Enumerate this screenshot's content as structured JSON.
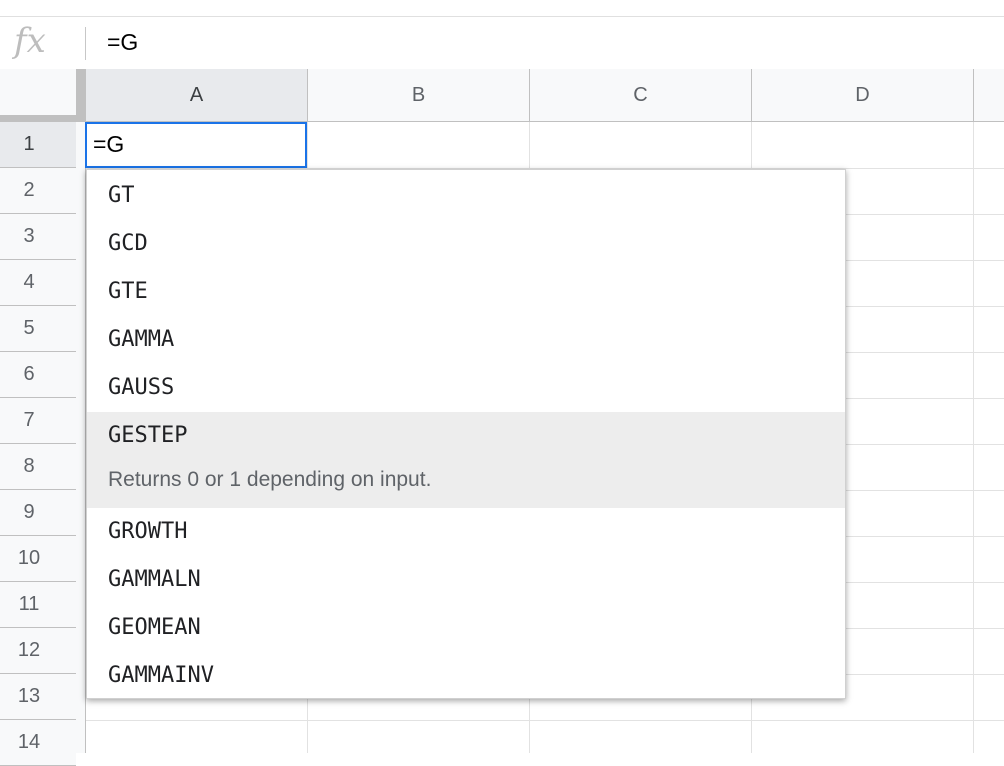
{
  "formula_bar": {
    "fx_label": "fx",
    "value": "=G"
  },
  "columns": [
    "A",
    "B",
    "C",
    "D"
  ],
  "rows": [
    "1",
    "2",
    "3",
    "4",
    "5",
    "6",
    "7",
    "8",
    "9",
    "10",
    "11",
    "12",
    "13",
    "14"
  ],
  "active_cell": {
    "column": "A",
    "row": "1",
    "value": "=G"
  },
  "autocomplete": {
    "suggestions": [
      {
        "name": "GT"
      },
      {
        "name": "GCD"
      },
      {
        "name": "GTE"
      },
      {
        "name": "GAMMA"
      },
      {
        "name": "GAUSS"
      },
      {
        "name": "GESTEP",
        "description": "Returns 0 or 1 depending on input.",
        "highlighted": true
      },
      {
        "name": "GROWTH"
      },
      {
        "name": "GAMMALN"
      },
      {
        "name": "GEOMEAN"
      },
      {
        "name": "GAMMAINV"
      }
    ]
  },
  "colors": {
    "selection_border": "#1a73e8",
    "header_bg": "#f8f9fa",
    "highlight_bg": "#ededed"
  }
}
